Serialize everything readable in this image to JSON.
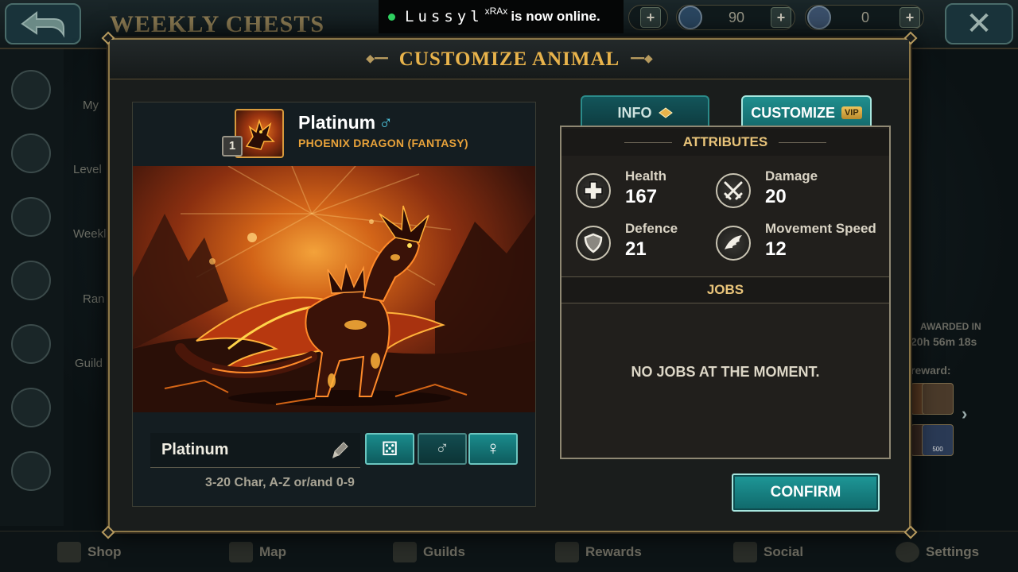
{
  "background": {
    "screen_title": "WEEKLY CHESTS",
    "currencies": [
      {
        "icon": "gem-icon",
        "amount": "90"
      },
      {
        "icon": "crystal-icon",
        "amount": "0"
      }
    ],
    "menu_labels": [
      "My",
      "Level",
      "Weekl",
      "Ran",
      "Guild"
    ],
    "right_panel": {
      "awarded_in_label": "AWARDED IN",
      "timer": "20h 56m 18s",
      "reward_label": "reward:",
      "reward_badge": "500"
    },
    "bottom_nav": [
      {
        "label": "Shop",
        "icon": "basket-icon"
      },
      {
        "label": "Map",
        "icon": "map-icon"
      },
      {
        "label": "Guilds",
        "icon": "guild-shield-icon"
      },
      {
        "label": "Rewards",
        "icon": "chest-icon"
      },
      {
        "label": "Social",
        "icon": "people-icon"
      },
      {
        "label": "Settings",
        "icon": "gear-icon"
      }
    ]
  },
  "toast": {
    "user": "Lussyl",
    "tag": "xRAx",
    "message": "is now online."
  },
  "modal": {
    "title": "CUSTOMIZE ANIMAL",
    "animal": {
      "level": "1",
      "name": "Platinum",
      "gender_symbol": "♂",
      "breed": "PHOENIX DRAGON (FANTASY)"
    },
    "name_input": {
      "value": "Platinum",
      "hint": "3-20 Char, A-Z or/and 0-9"
    },
    "buttons": {
      "random": "⚄",
      "male": "♂",
      "female": "♀"
    },
    "tabs": [
      {
        "label": "INFO",
        "active": false
      },
      {
        "label": "CUSTOMIZE",
        "badge": "VIP",
        "active": true
      }
    ],
    "attributes_heading": "ATTRIBUTES",
    "attributes": [
      {
        "label": "Health",
        "value": "167",
        "icon": "health-cross-icon"
      },
      {
        "label": "Damage",
        "value": "20",
        "icon": "crossed-swords-icon"
      },
      {
        "label": "Defence",
        "value": "21",
        "icon": "shield-icon"
      },
      {
        "label": "Movement Speed",
        "value": "12",
        "icon": "wing-icon"
      }
    ],
    "jobs_heading": "JOBS",
    "jobs_empty": "NO JOBS AT THE MOMENT.",
    "confirm_label": "CONFIRM"
  },
  "colors": {
    "accent_gold": "#e8b34b",
    "teal_button": "#1e9898",
    "male_blue": "#4fc7e0",
    "breed_orange": "#e8a23a"
  }
}
